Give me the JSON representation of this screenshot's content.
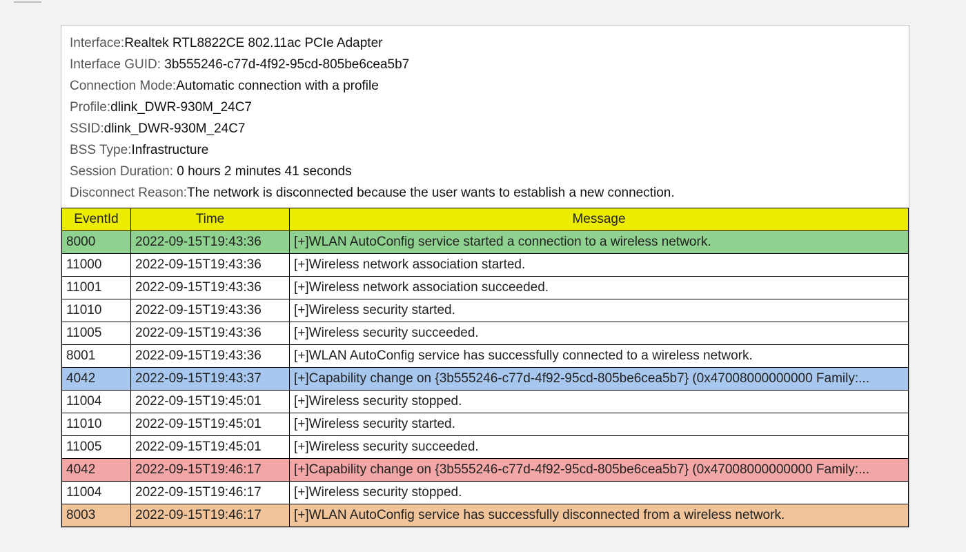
{
  "info": {
    "interface_label": "Interface:",
    "interface_value": "Realtek RTL8822CE 802.11ac PCIe Adapter",
    "guid_label": "Interface GUID: ",
    "guid_value": "3b555246-c77d-4f92-95cd-805be6cea5b7",
    "mode_label": "Connection Mode:",
    "mode_value": "Automatic connection with a profile",
    "profile_label": "Profile:",
    "profile_value": "dlink_DWR-930M_24C7",
    "ssid_label": "SSID:",
    "ssid_value": "dlink_DWR-930M_24C7",
    "bss_label": "BSS Type:",
    "bss_value": "Infrastructure",
    "duration_label": "Session Duration: ",
    "duration_value": "0 hours 2 minutes 41 seconds",
    "reason_label": "Disconnect Reason:",
    "reason_value": "The network is disconnected because the user wants to establish a new connection."
  },
  "columns": {
    "id": "EventId",
    "time": "Time",
    "msg": "Message"
  },
  "rows": [
    {
      "cls": "green",
      "id": "8000",
      "time": "2022-09-15T19:43:36",
      "msg": "[+]WLAN AutoConfig service started a connection to a wireless network."
    },
    {
      "cls": "white",
      "id": "11000",
      "time": "2022-09-15T19:43:36",
      "msg": "[+]Wireless network association started."
    },
    {
      "cls": "white",
      "id": "11001",
      "time": "2022-09-15T19:43:36",
      "msg": "[+]Wireless network association succeeded."
    },
    {
      "cls": "white",
      "id": "11010",
      "time": "2022-09-15T19:43:36",
      "msg": "[+]Wireless security started."
    },
    {
      "cls": "white",
      "id": "11005",
      "time": "2022-09-15T19:43:36",
      "msg": "[+]Wireless security succeeded."
    },
    {
      "cls": "white",
      "id": "8001",
      "time": "2022-09-15T19:43:36",
      "msg": "[+]WLAN AutoConfig service has successfully connected to a wireless network."
    },
    {
      "cls": "blue",
      "id": "4042",
      "time": "2022-09-15T19:43:37",
      "msg": "[+]Capability change on {3b555246-c77d-4f92-95cd-805be6cea5b7} (0x47008000000000 Family:..."
    },
    {
      "cls": "white",
      "id": "11004",
      "time": "2022-09-15T19:45:01",
      "msg": "[+]Wireless security stopped."
    },
    {
      "cls": "white",
      "id": "11010",
      "time": "2022-09-15T19:45:01",
      "msg": "[+]Wireless security started."
    },
    {
      "cls": "white",
      "id": "11005",
      "time": "2022-09-15T19:45:01",
      "msg": "[+]Wireless security succeeded."
    },
    {
      "cls": "red",
      "id": "4042",
      "time": "2022-09-15T19:46:17",
      "msg": "[+]Capability change on {3b555246-c77d-4f92-95cd-805be6cea5b7} (0x47008000000000 Family:..."
    },
    {
      "cls": "white",
      "id": "11004",
      "time": "2022-09-15T19:46:17",
      "msg": "[+]Wireless security stopped."
    },
    {
      "cls": "orange",
      "id": "8003",
      "time": "2022-09-15T19:46:17",
      "msg": "[+]WLAN AutoConfig service has successfully disconnected from a wireless network."
    }
  ]
}
